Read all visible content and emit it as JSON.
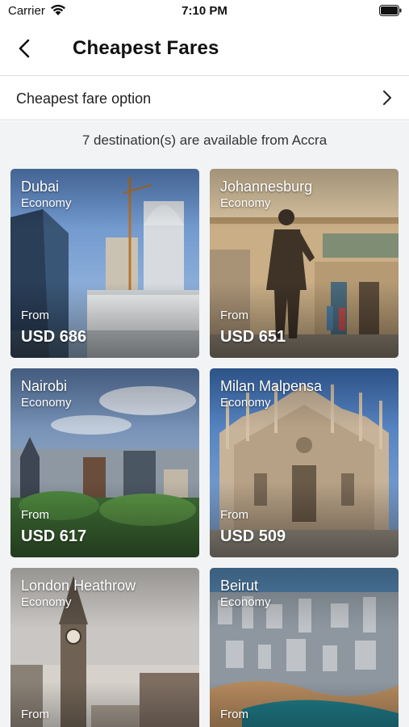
{
  "status_bar": {
    "carrier": "Carrier",
    "time": "7:10 PM"
  },
  "nav": {
    "title": "Cheapest Fares"
  },
  "option_row": {
    "label": "Cheapest fare option"
  },
  "availability": "7 destination(s) are available from Accra",
  "destinations": [
    {
      "city": "Dubai",
      "cabin": "Economy",
      "from_label": "From",
      "price": "USD 686"
    },
    {
      "city": "Johannesburg",
      "cabin": "Economy",
      "from_label": "From",
      "price": "USD 651"
    },
    {
      "city": "Nairobi",
      "cabin": "Economy",
      "from_label": "From",
      "price": "USD 617"
    },
    {
      "city": "Milan Malpensa",
      "cabin": "Economy",
      "from_label": "From",
      "price": "USD 509"
    },
    {
      "city": "London Heathrow",
      "cabin": "Economy",
      "from_label": "From",
      "price": ""
    },
    {
      "city": "Beirut",
      "cabin": "Economy",
      "from_label": "From",
      "price": ""
    }
  ],
  "icons": {
    "back": "chevron-left-icon",
    "option": "chevron-right-icon",
    "wifi": "wifi-icon",
    "battery": "battery-icon"
  }
}
